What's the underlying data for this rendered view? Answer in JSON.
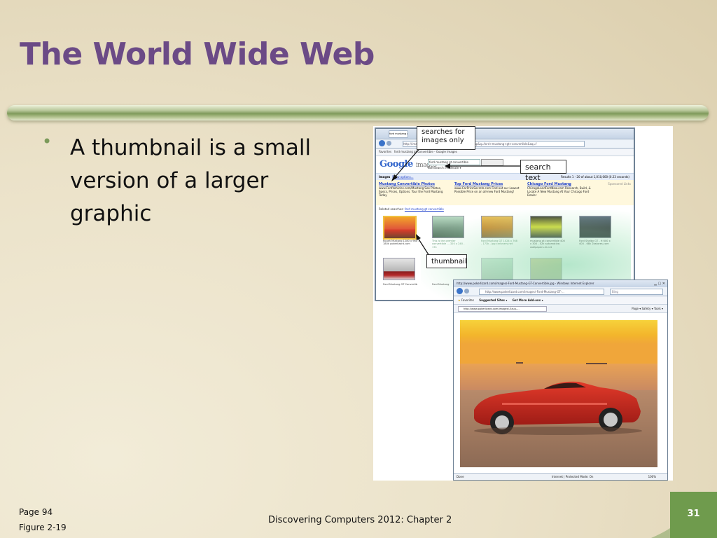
{
  "slide": {
    "title": "The World Wide Web",
    "bullets": [
      "A thumbnail is a small version of a larger graphic"
    ]
  },
  "figure": {
    "callouts": {
      "searches": "searches for images only",
      "search_text": "search text",
      "thumbnail": "thumbnail"
    },
    "browser1": {
      "tab": "ford mustang gt conv...",
      "favorites": "Favorites",
      "tab_title": "ford mustang gt convertible - Google Images",
      "address": "http://images.google.com/images?hl=en&source=hp&q=ford+mustang+gt+convertible&aq=f",
      "logo": "Google",
      "logo_suffix": "images",
      "search_text": "ford mustang gt convertible",
      "safesearch": "SafeSearch: Moderate ▾",
      "images_label": "Images",
      "show_options": "Show options...",
      "results": "Results 1 - 20 of about 1,010,000 (0.23 seconds)",
      "sponsored": "Sponsored Links",
      "ads": [
        {
          "title": "Mustang Convertible Photos",
          "body": "www.FordVehicles.com/Mustang  See Photos, Specs, Prices, Options. Tour the Ford Mustang Today"
        },
        {
          "title": "Top Ford Mustang Prices",
          "body": "www.CarPriceSecrets.com   Find out our Lowest Possible Price on an all-new Ford Mustang!"
        },
        {
          "title": "Chicago Ford Mustang",
          "body": "ChicagoLandFordNow.com   Research, Build, & Locate A New Mustang At Your Chicago Ford Dealer"
        }
      ],
      "related_label": "Related searches:",
      "related_link": "ford mustang gt convertible",
      "thumb_captions": [
        "Roush Mustang 1280 x 960 - 180k pokerlizard.com",
        "This is the premier convertible ... 320 x 240 - 17k",
        "Ford Mustang GT 1024 x 768 - 173k - jpg carlovers.net",
        "mustang gt convertible 400 x 300 - 42k automotive-wallpapers-hi.net",
        "Ford Shelby GT - H 600 x 400 - 68k 2bstores.com",
        "Ford Mustang GT Convertib",
        "Ford Mustang"
      ]
    },
    "browser2": {
      "title": "http://www.pokerlizard.com/images/-Ford-Mustang-GT-Convertible.jpg - Windows Internet Explorer",
      "address": "http://www.pokerlizard.com/images/-Ford-Mustang-GT-...",
      "bing": "Bing",
      "favorites": "Favorites",
      "suggested": "Suggested Sites ▾",
      "addons": "Get More Add-ons ▾",
      "tab_url": "http://www.pokerlizard.com/images/-Ezup-...",
      "menus": "Page ▾  Safety ▾  Tools ▾",
      "status_left": "Done",
      "status_mid": "Internet | Protected Mode: On",
      "zoom": "100%"
    }
  },
  "footer": {
    "page": "Page 94",
    "figure": "Figure 2-19",
    "course": "Discovering Computers 2012: Chapter 2",
    "slide_number": "31"
  },
  "colors": {
    "title": "#6b4a86",
    "accent_green": "#6f9b4d",
    "background": "#ebe2c9"
  }
}
